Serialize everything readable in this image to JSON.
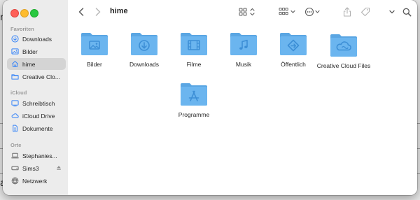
{
  "window": {
    "title": "hime"
  },
  "sidebar": {
    "sections": [
      {
        "title": "Favoriten",
        "items": [
          {
            "label": "Downloads",
            "icon": "download-circle-icon",
            "selected": false
          },
          {
            "label": "Bilder",
            "icon": "photo-icon",
            "selected": false
          },
          {
            "label": "hime",
            "icon": "home-icon",
            "selected": true
          },
          {
            "label": "Creative Clo...",
            "icon": "folder-icon",
            "selected": false
          }
        ]
      },
      {
        "title": "iCloud",
        "items": [
          {
            "label": "Schreibtisch",
            "icon": "desktop-icon",
            "selected": false
          },
          {
            "label": "iCloud Drive",
            "icon": "cloud-icon",
            "selected": false
          },
          {
            "label": "Dokumente",
            "icon": "document-icon",
            "selected": false
          }
        ]
      },
      {
        "title": "Orte",
        "items": [
          {
            "label": "Stephanies...",
            "icon": "laptop-icon",
            "selected": false
          },
          {
            "label": "Sims3",
            "icon": "disk-icon",
            "selected": false,
            "eject": true
          },
          {
            "label": "Netzwerk",
            "icon": "globe-icon",
            "selected": false
          }
        ]
      }
    ]
  },
  "content": {
    "folders": [
      {
        "label": "Bilder",
        "glyph": "photo"
      },
      {
        "label": "Downloads",
        "glyph": "download"
      },
      {
        "label": "Filme",
        "glyph": "film"
      },
      {
        "label": "Musik",
        "glyph": "music"
      },
      {
        "label": "Öffentlich",
        "glyph": "public"
      },
      {
        "label": "Creative Cloud Files",
        "glyph": "creative-cloud"
      },
      {
        "label": "Programme",
        "glyph": "apps"
      }
    ]
  },
  "colors": {
    "accent": "#3b82f6",
    "folder_fill": "#6bb5ef",
    "folder_tab": "#5aa6e3",
    "folder_glyph": "#3d8fd6",
    "sidebar_bg": "#ececec",
    "sidebar_selected": "#d4d4d4",
    "sidebar_icon": "#3a86f7",
    "close": "#fe5f57",
    "minimize": "#febc2e",
    "zoom": "#28c840"
  },
  "background": {
    "chars": [
      "m",
      "a"
    ]
  }
}
